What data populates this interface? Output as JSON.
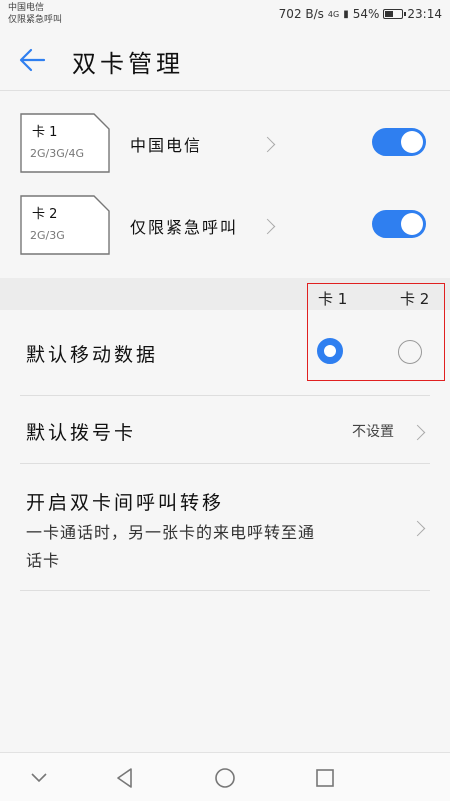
{
  "status_bar": {
    "carrier_1": "中国电信",
    "carrier_2": "仅限紧急呼叫",
    "speed": "702 B/s",
    "network": "4G",
    "battery": "54%",
    "battery_level": 0.54,
    "time": "23:14"
  },
  "header": {
    "title": "双卡管理"
  },
  "sims": [
    {
      "name": "卡 1",
      "network": "2G/3G/4G",
      "carrier": "中国电信",
      "enabled": true
    },
    {
      "name": "卡 2",
      "network": "2G/3G",
      "carrier": "仅限紧急呼叫",
      "enabled": true
    }
  ],
  "columns": {
    "sim1": "卡 1",
    "sim2": "卡 2"
  },
  "default_data": {
    "label": "默认移动数据",
    "selected": "sim1"
  },
  "default_dial": {
    "label": "默认拨号卡",
    "value": "不设置"
  },
  "call_forward": {
    "label": "开启双卡间呼叫转移",
    "description": "一卡通话时，另一张卡的来电呼转至通话卡"
  },
  "colors": {
    "accent": "#2f7ff0",
    "highlight_box": "#e02020"
  }
}
